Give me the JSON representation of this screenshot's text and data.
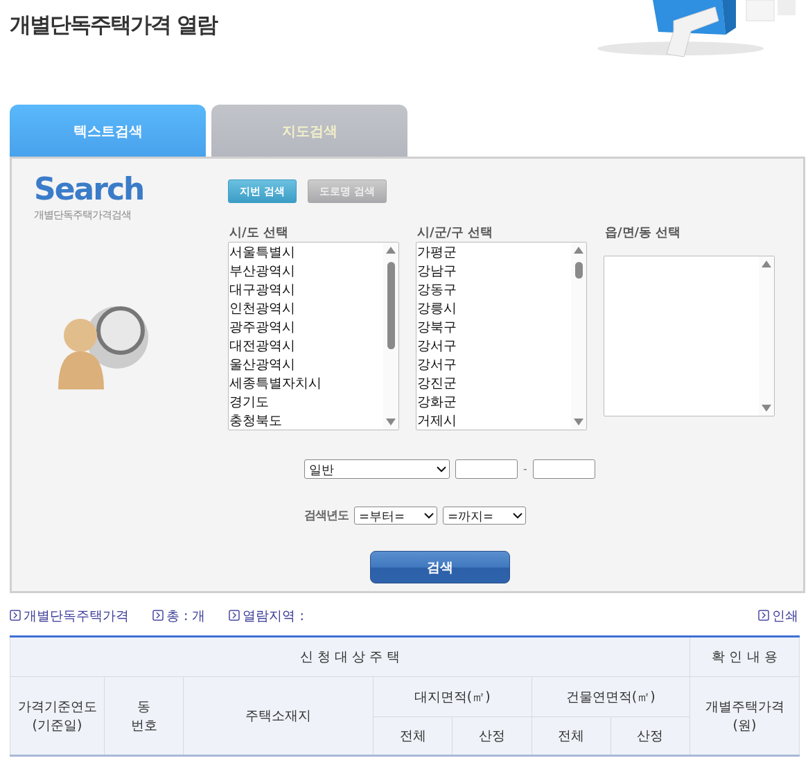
{
  "title": "개별단독주택가격 열람",
  "tabs": [
    {
      "label": "텍스트검색",
      "selected": true
    },
    {
      "label": "지도검색",
      "selected": false
    }
  ],
  "search_logo": {
    "title": "Search",
    "subtitle": "개별단독주택가격검색"
  },
  "mode_buttons": [
    {
      "label": "지번 검색",
      "selected": true
    },
    {
      "label": "도로명 검색",
      "selected": false
    }
  ],
  "lists": [
    {
      "label": "시/도 선택",
      "items": [
        "서울특별시",
        "부산광역시",
        "대구광역시",
        "인천광역시",
        "광주광역시",
        "대전광역시",
        "울산광역시",
        "세종특별자치시",
        "경기도",
        "충청북도"
      ]
    },
    {
      "label": "시/군/구 선택",
      "items": [
        "가평군",
        "강남구",
        "강동구",
        "강릉시",
        "강북구",
        "강서구",
        "강서구",
        "강진군",
        "강화군",
        "거제시"
      ]
    },
    {
      "label": "읍/면/동 선택"
    }
  ],
  "lot": {
    "type": "일반",
    "separator": "-"
  },
  "year": {
    "label": "검색년도",
    "from": "=부터=",
    "to": "=까지="
  },
  "search_button": "검색",
  "info_links": [
    "개별단독주택가격",
    "총 : 개",
    "열람지역 :"
  ],
  "print_link": "인쇄",
  "table": {
    "groups": [
      {
        "label": "신 청 대 상 주 택",
        "columns": [
          {
            "label": "가격기준연도\n(기준일)"
          },
          {
            "label": "동\n번호"
          },
          {
            "label": "주택소재지"
          },
          {
            "label": "대지면적(㎡)",
            "sub": [
              "전체",
              "산정"
            ]
          },
          {
            "label": "건물연면적(㎡)",
            "sub": [
              "전체",
              "산정"
            ]
          }
        ]
      },
      {
        "label": "확 인 내 용",
        "columns": [
          {
            "label": "개별주택가격\n(원)"
          }
        ]
      }
    ]
  }
}
